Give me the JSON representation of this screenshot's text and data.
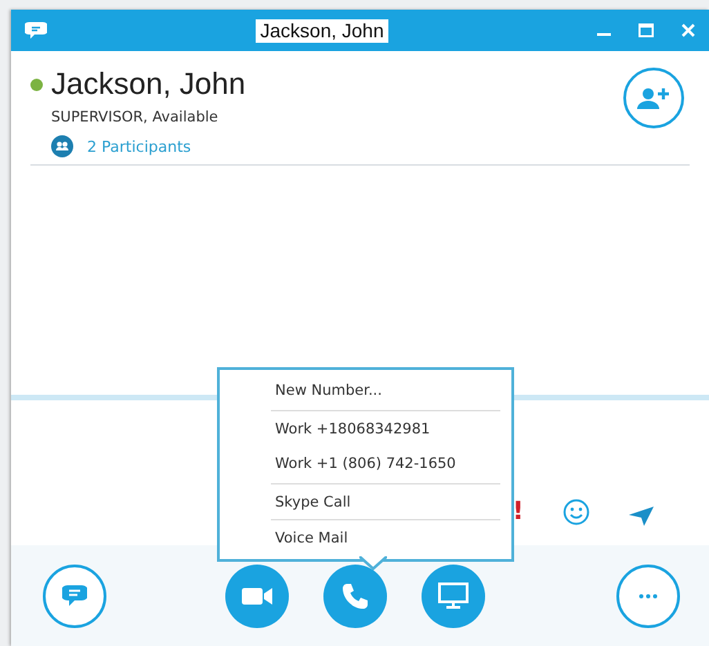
{
  "window": {
    "title": "Jackson, John"
  },
  "contact": {
    "name": "Jackson, John",
    "online": true,
    "status_line": "SUPERVISOR, Available",
    "participants": "2 Participants"
  },
  "call_menu": {
    "items": [
      {
        "label": "New Number..."
      },
      {
        "label": "Work +18068342981"
      },
      {
        "label": "Work +1 (806) 742-1650"
      },
      {
        "label": "Skype Call"
      },
      {
        "label": "Voice Mail"
      }
    ]
  },
  "compose": {
    "important_mark": "!"
  }
}
